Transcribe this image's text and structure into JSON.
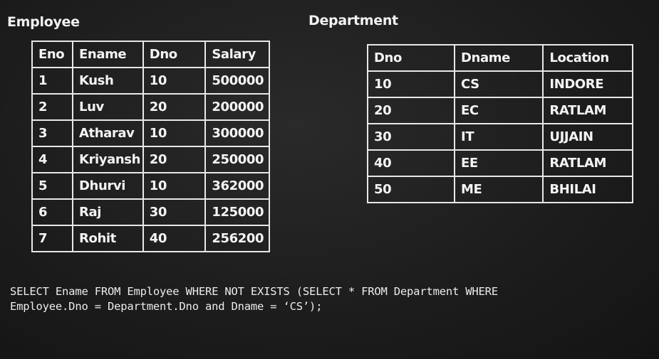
{
  "employee": {
    "title": "Employee",
    "headers": [
      "Eno",
      "Ename",
      "Dno",
      "Salary"
    ],
    "rows": [
      [
        "1",
        "Kush",
        "10",
        "500000"
      ],
      [
        "2",
        "Luv",
        "20",
        "200000"
      ],
      [
        "3",
        "Atharav",
        "10",
        "300000"
      ],
      [
        "4",
        "Kriyansh",
        "20",
        "250000"
      ],
      [
        "5",
        "Dhurvi",
        "10",
        "362000"
      ],
      [
        "6",
        "Raj",
        "30",
        "125000"
      ],
      [
        "7",
        "Rohit",
        "40",
        "256200"
      ]
    ]
  },
  "department": {
    "title": "Department",
    "headers": [
      "Dno",
      "Dname",
      "Location"
    ],
    "rows": [
      [
        "10",
        "CS",
        "INDORE"
      ],
      [
        "20",
        "EC",
        "RATLAM"
      ],
      [
        "30",
        "IT",
        "UJJAIN"
      ],
      [
        "40",
        "EE",
        "RATLAM"
      ],
      [
        "50",
        "ME",
        "BHILAI"
      ]
    ]
  },
  "query": {
    "line1": "SELECT Ename FROM Employee WHERE NOT EXISTS (SELECT * FROM Department WHERE",
    "line2": "Employee.Dno = Department.Dno and Dname = ‘CS’);"
  }
}
